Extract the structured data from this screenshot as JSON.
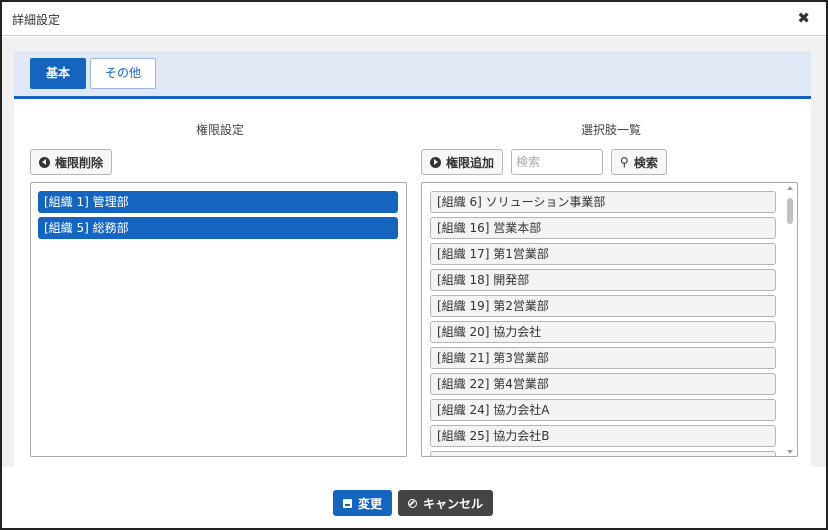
{
  "dialog": {
    "title": "詳細設定",
    "close_icon": "close-icon"
  },
  "tabs": [
    {
      "label": "基本",
      "active": true
    },
    {
      "label": "その他",
      "active": false
    }
  ],
  "left_panel": {
    "title": "権限設定",
    "remove_button_label": "権限削除",
    "selected_items": [
      "[組織 1] 管理部",
      "[組織 5] 総務部"
    ]
  },
  "right_panel": {
    "title": "選択肢一覧",
    "add_button_label": "権限追加",
    "search_placeholder": "検索",
    "search_value": "",
    "search_button_label": "検索",
    "options": [
      "[組織 6] ソリューション事業部",
      "[組織 16] 営業本部",
      "[組織 17] 第1営業部",
      "[組織 18] 開発部",
      "[組織 19] 第2営業部",
      "[組織 20] 協力会社",
      "[組織 21] 第3営業部",
      "[組織 22] 第4営業部",
      "[組織 24] 協力会社A",
      "[組織 25] 協力会社B"
    ]
  },
  "footer": {
    "save_label": "変更",
    "cancel_label": "キャンセル"
  },
  "colors": {
    "primary": "#1565c0",
    "tabbar_bg": "#dfe8f4",
    "cancel_bg": "#444444"
  }
}
